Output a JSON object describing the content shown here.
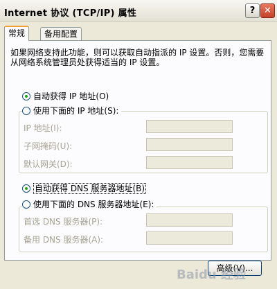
{
  "window": {
    "title": "Internet 协议 (TCP/IP) 属性",
    "help_label": "?",
    "close_label": "✕"
  },
  "tabs": [
    {
      "label": "常规",
      "active": true
    },
    {
      "label": "备用配置",
      "active": false
    }
  ],
  "description": "如果网络支持此功能，则可以获取自动指派的 IP 设置。否则，您需要从网络系统管理员处获得适当的 IP 设置。",
  "ip_section": {
    "auto_label": "自动获得 IP 地址(O)",
    "manual_label": "使用下面的 IP 地址(S):",
    "selected": "auto",
    "fields": [
      {
        "label": "IP 地址(I):",
        "value": ""
      },
      {
        "label": "子网掩码(U):",
        "value": ""
      },
      {
        "label": "默认网关(D):",
        "value": ""
      }
    ]
  },
  "dns_section": {
    "auto_label": "自动获得 DNS 服务器地址(B)",
    "manual_label": "使用下面的 DNS 服务器地址(E):",
    "selected": "auto",
    "fields": [
      {
        "label": "首选 DNS 服务器(P):",
        "value": ""
      },
      {
        "label": "备用 DNS 服务器(A):",
        "value": ""
      }
    ]
  },
  "advanced_label": "高级(V)...",
  "watermark": "Baidu 经验",
  "colors": {
    "window_bg": "#ece9d8",
    "tab_accent": "#f0a030",
    "radio_dot": "#21a121",
    "disabled_text": "#a6a392"
  }
}
